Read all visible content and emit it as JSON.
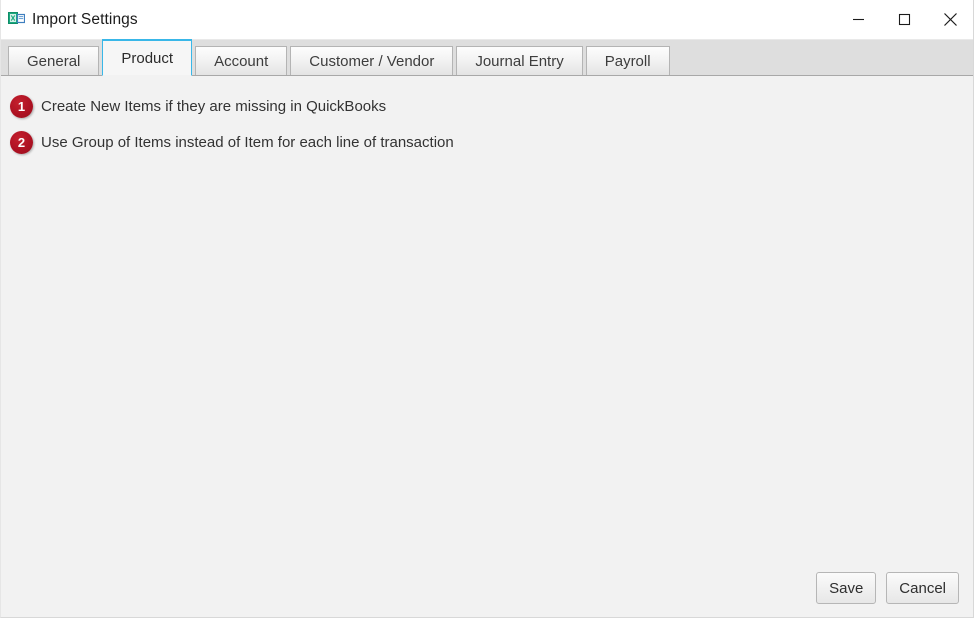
{
  "window": {
    "title": "Import Settings",
    "icon": "excel-import-icon",
    "controls": [
      {
        "name": "minimize-button",
        "label": "—"
      },
      {
        "name": "maximize-button",
        "label": "□"
      },
      {
        "name": "close-button",
        "label": "✕"
      }
    ]
  },
  "tabs": {
    "active": "Product",
    "items": [
      {
        "label": "General",
        "active": false
      },
      {
        "label": "Product",
        "active": true
      },
      {
        "label": "Account",
        "active": false
      },
      {
        "label": "Customer / Vendor",
        "active": false
      },
      {
        "label": "Journal Entry",
        "active": false
      },
      {
        "label": "Payroll",
        "active": false
      }
    ]
  },
  "content": {
    "options": [
      {
        "number": "1",
        "label": "Create New Items if they are missing in QuickBooks"
      },
      {
        "number": "2",
        "label": "Use Group of Items instead of Item for each line of transaction"
      }
    ]
  },
  "footer": {
    "save_label": "Save",
    "cancel_label": "Cancel"
  },
  "colors": {
    "active_tab_accent": "#39b7e8",
    "badge_red": "#ad1122",
    "content_background": "#f2f2f2",
    "tabstrip_background": "#dedede",
    "text": "#333333"
  }
}
